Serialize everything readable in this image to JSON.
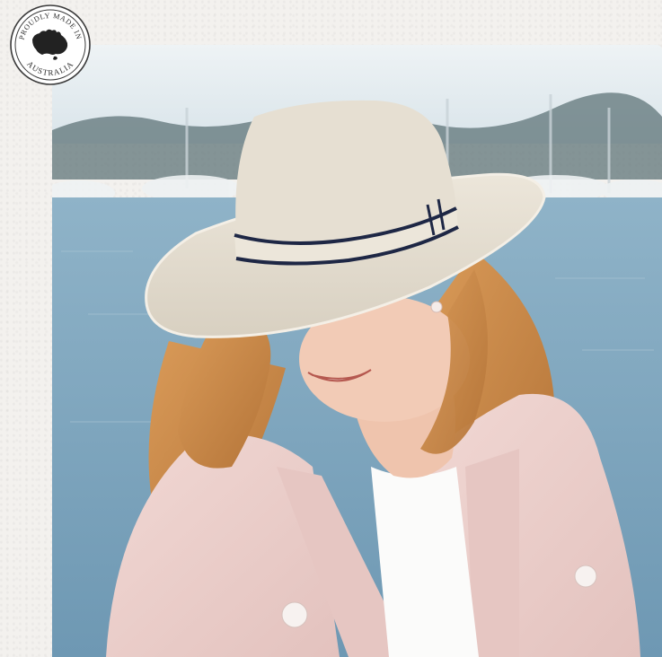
{
  "badge": {
    "top_text": "PROUDLY MADE IN",
    "bottom_text": "AUSTRALIA",
    "icon": "australia-map-icon"
  },
  "photo": {
    "subject": "woman-in-straw-fedora"
  },
  "colors": {
    "paper": "#f3f1ee",
    "sky": "#dfe9ee",
    "water": "#7fa6bf",
    "hat": "#e4ddcf",
    "hat_band_stripe": "#1e2745",
    "hair": "#c98a4c",
    "blazer": "#ecd0cc",
    "tshirt": "#fbfbfa",
    "skin": "#f0c9b4"
  }
}
